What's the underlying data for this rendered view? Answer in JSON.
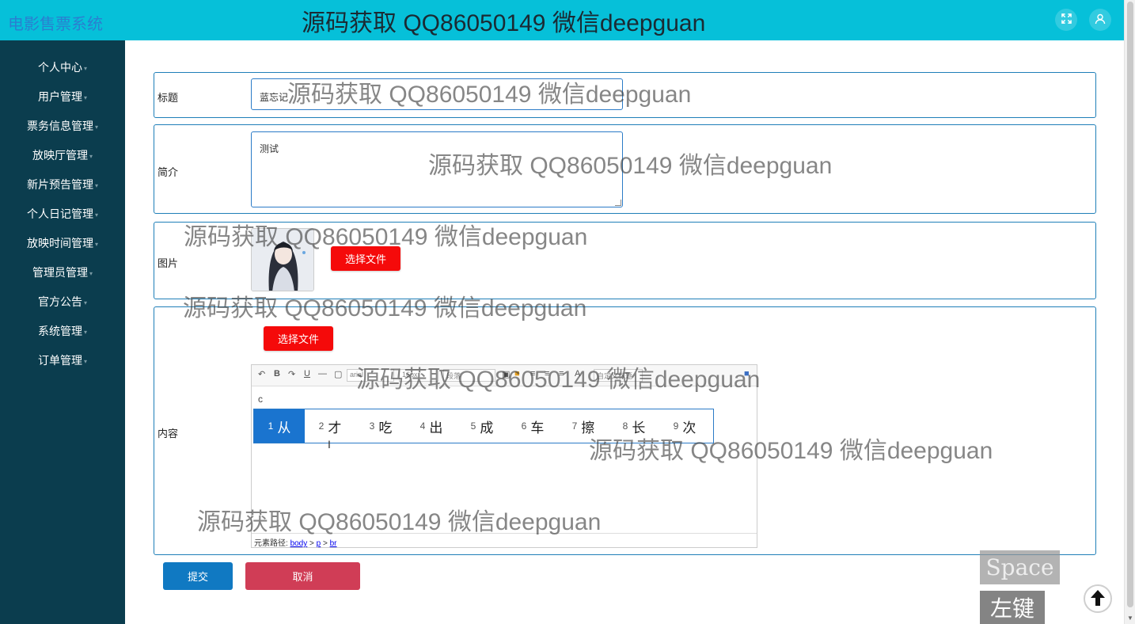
{
  "app": {
    "title": "电影售票系统"
  },
  "header": {
    "fullscreen_icon": "expand-icon",
    "user_icon": "user-icon"
  },
  "sidebar": {
    "items": [
      {
        "label": "个人中心"
      },
      {
        "label": "用户管理"
      },
      {
        "label": "票务信息管理"
      },
      {
        "label": "放映厅管理"
      },
      {
        "label": "新片预告管理"
      },
      {
        "label": "个人日记管理"
      },
      {
        "label": "放映时间管理"
      },
      {
        "label": "管理员管理"
      },
      {
        "label": "官方公告"
      },
      {
        "label": "系统管理"
      },
      {
        "label": "订单管理"
      }
    ]
  },
  "form": {
    "title_label": "标题",
    "title_value": "蓝忘记",
    "intro_label": "简介",
    "intro_value": "测试",
    "image_label": "图片",
    "choose_file": "选择文件",
    "content_label": "内容"
  },
  "editor": {
    "font_select": "arial",
    "size_select": "16px",
    "para_select": "段落",
    "custom_title": "自定义标题",
    "typed_text": "c",
    "path_label": "元素路径:",
    "path": [
      "body",
      "p",
      "br"
    ]
  },
  "ime": {
    "candidates": [
      {
        "num": "1",
        "char": "从"
      },
      {
        "num": "2",
        "char": "才"
      },
      {
        "num": "3",
        "char": "吃"
      },
      {
        "num": "4",
        "char": "出"
      },
      {
        "num": "5",
        "char": "成"
      },
      {
        "num": "6",
        "char": "车"
      },
      {
        "num": "7",
        "char": "擦"
      },
      {
        "num": "8",
        "char": "长"
      },
      {
        "num": "9",
        "char": "次"
      }
    ]
  },
  "actions": {
    "submit": "提交",
    "cancel": "取消"
  },
  "overlay": {
    "watermark": "源码获取 QQ86050149 微信deepguan",
    "key_space": "Space",
    "key_left": "左键"
  },
  "colors": {
    "header": "#06c0d9",
    "sidebar": "#0b3d4e",
    "border": "#1f7fb8",
    "choose_button": "#f50a0a",
    "submit_button": "#1079c2",
    "cancel_button": "#d03d56",
    "ime_active": "#1a74cf"
  }
}
